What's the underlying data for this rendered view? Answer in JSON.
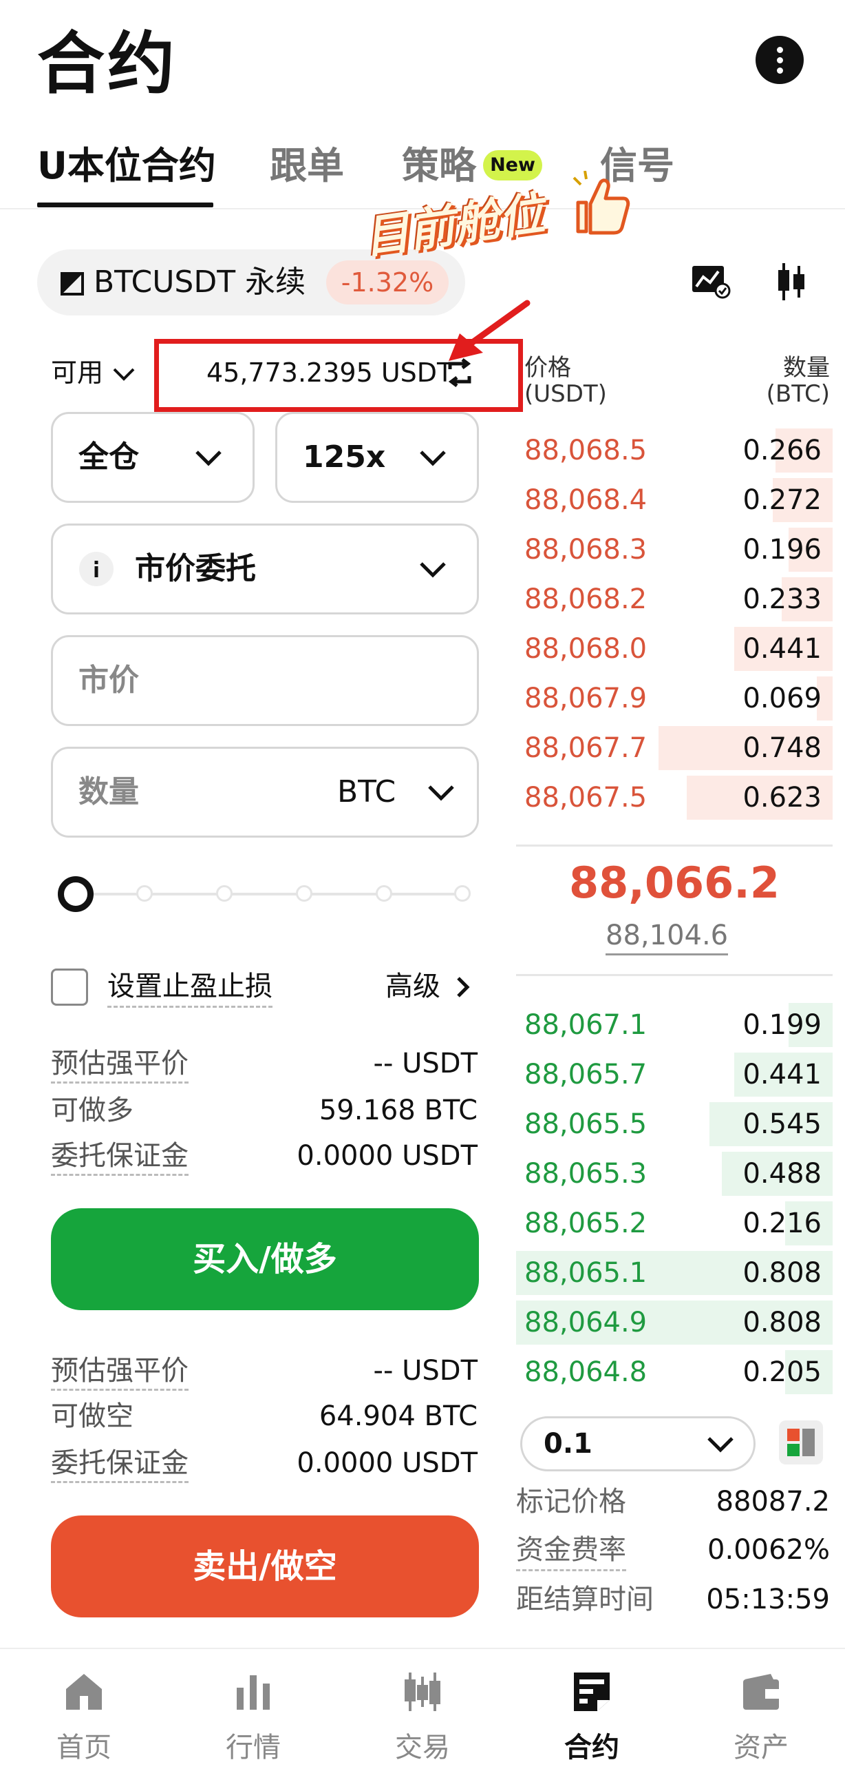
{
  "header": {
    "title": "合约"
  },
  "tabs": [
    {
      "label": "U本位合约",
      "active": true
    },
    {
      "label": "跟单"
    },
    {
      "label": "策略",
      "badge": "New"
    },
    {
      "label": "信号"
    }
  ],
  "overlay": {
    "sticker_text": "目前舱位"
  },
  "symbol": {
    "name": "BTCUSDT  永续",
    "change": "-1.32%"
  },
  "available": {
    "label": "可用",
    "value": "45,773.2395 USDT"
  },
  "order_form": {
    "margin_mode": "全仓",
    "leverage": "125x",
    "order_type": "市价委托",
    "price_placeholder": "市价",
    "qty_placeholder": "数量",
    "qty_unit": "BTC",
    "slider_percent": 0,
    "tpsl_label": "设置止盈止损",
    "advanced_label": "高级",
    "long_info": [
      {
        "label": "预估强平价",
        "value": "-- USDT",
        "dashed": true
      },
      {
        "label": "可做多",
        "value": "59.168 BTC",
        "dashed": false
      },
      {
        "label": "委托保证金",
        "value": "0.0000 USDT",
        "dashed": true
      }
    ],
    "buy_label": "买入/做多",
    "short_info": [
      {
        "label": "预估强平价",
        "value": "-- USDT",
        "dashed": true
      },
      {
        "label": "可做空",
        "value": "64.904 BTC",
        "dashed": false
      },
      {
        "label": "委托保证金",
        "value": "0.0000 USDT",
        "dashed": true
      }
    ],
    "sell_label": "卖出/做空"
  },
  "order_book": {
    "price_header": "价格",
    "price_unit": "(USDT)",
    "qty_header": "数量",
    "qty_unit": "(BTC)",
    "asks": [
      {
        "price": "88,068.5",
        "qty": "0.266",
        "depth": 0.18
      },
      {
        "price": "88,068.4",
        "qty": "0.272",
        "depth": 0.19
      },
      {
        "price": "88,068.3",
        "qty": "0.196",
        "depth": 0.14
      },
      {
        "price": "88,068.2",
        "qty": "0.233",
        "depth": 0.16
      },
      {
        "price": "88,068.0",
        "qty": "0.441",
        "depth": 0.31
      },
      {
        "price": "88,067.9",
        "qty": "0.069",
        "depth": 0.05
      },
      {
        "price": "88,067.7",
        "qty": "0.748",
        "depth": 0.55
      },
      {
        "price": "88,067.5",
        "qty": "0.623",
        "depth": 0.46
      }
    ],
    "last_price": "88,066.2",
    "index_price": "88,104.6",
    "bids": [
      {
        "price": "88,067.1",
        "qty": "0.199",
        "depth": 0.14
      },
      {
        "price": "88,065.7",
        "qty": "0.441",
        "depth": 0.31
      },
      {
        "price": "88,065.5",
        "qty": "0.545",
        "depth": 0.39
      },
      {
        "price": "88,065.3",
        "qty": "0.488",
        "depth": 0.35
      },
      {
        "price": "88,065.2",
        "qty": "0.216",
        "depth": 0.15
      },
      {
        "price": "88,065.1",
        "qty": "0.808",
        "depth": 1.0
      },
      {
        "price": "88,064.9",
        "qty": "0.808",
        "depth": 1.0
      },
      {
        "price": "88,064.8",
        "qty": "0.205",
        "depth": 0.15
      }
    ],
    "depth_step": "0.1",
    "stats": [
      {
        "label": "标记价格",
        "value": "88087.2",
        "dashed": false
      },
      {
        "label": "资金费率",
        "value": "0.0062%",
        "dashed": true
      },
      {
        "label": "距结算时间",
        "value": "05:13:59",
        "dashed": false
      }
    ]
  },
  "bottom_nav": [
    {
      "label": "首页",
      "icon": "home-icon"
    },
    {
      "label": "行情",
      "icon": "market-icon"
    },
    {
      "label": "交易",
      "icon": "trade-icon"
    },
    {
      "label": "合约",
      "icon": "futures-icon",
      "active": true
    },
    {
      "label": "资产",
      "icon": "wallet-icon"
    }
  ],
  "colors": {
    "buy": "#16a53c",
    "sell": "#e8512f",
    "ask_text": "#d9543a",
    "bid_text": "#1f9a40",
    "badge": "#d3f34b",
    "highlight_box": "#e11d1d"
  }
}
